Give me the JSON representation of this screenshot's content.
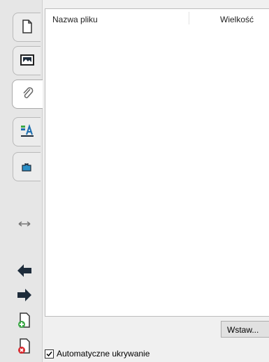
{
  "sidebar": {
    "tabs": [
      {
        "icon": "page-icon"
      },
      {
        "icon": "image-icon"
      },
      {
        "icon": "paperclip-icon"
      },
      {
        "icon": "text-style-icon"
      },
      {
        "icon": "puzzle-icon"
      }
    ],
    "buttons": [
      {
        "icon": "resize-arrows-icon"
      },
      {
        "icon": "arrow-left-icon"
      },
      {
        "icon": "arrow-right-icon"
      },
      {
        "icon": "add-page-icon"
      },
      {
        "icon": "remove-page-icon"
      }
    ]
  },
  "file_list": {
    "columns": [
      "Nazwa pliku",
      "Wielkość"
    ]
  },
  "insert_button": "Wstaw...",
  "autohide": {
    "label": "Automatyczne ukrywanie",
    "checked": true
  },
  "colors": {
    "accent_blue": "#1e6fb0",
    "dark_arrow": "#1d2b3a",
    "add_green": "#3aa845",
    "remove_red": "#d9262c"
  }
}
